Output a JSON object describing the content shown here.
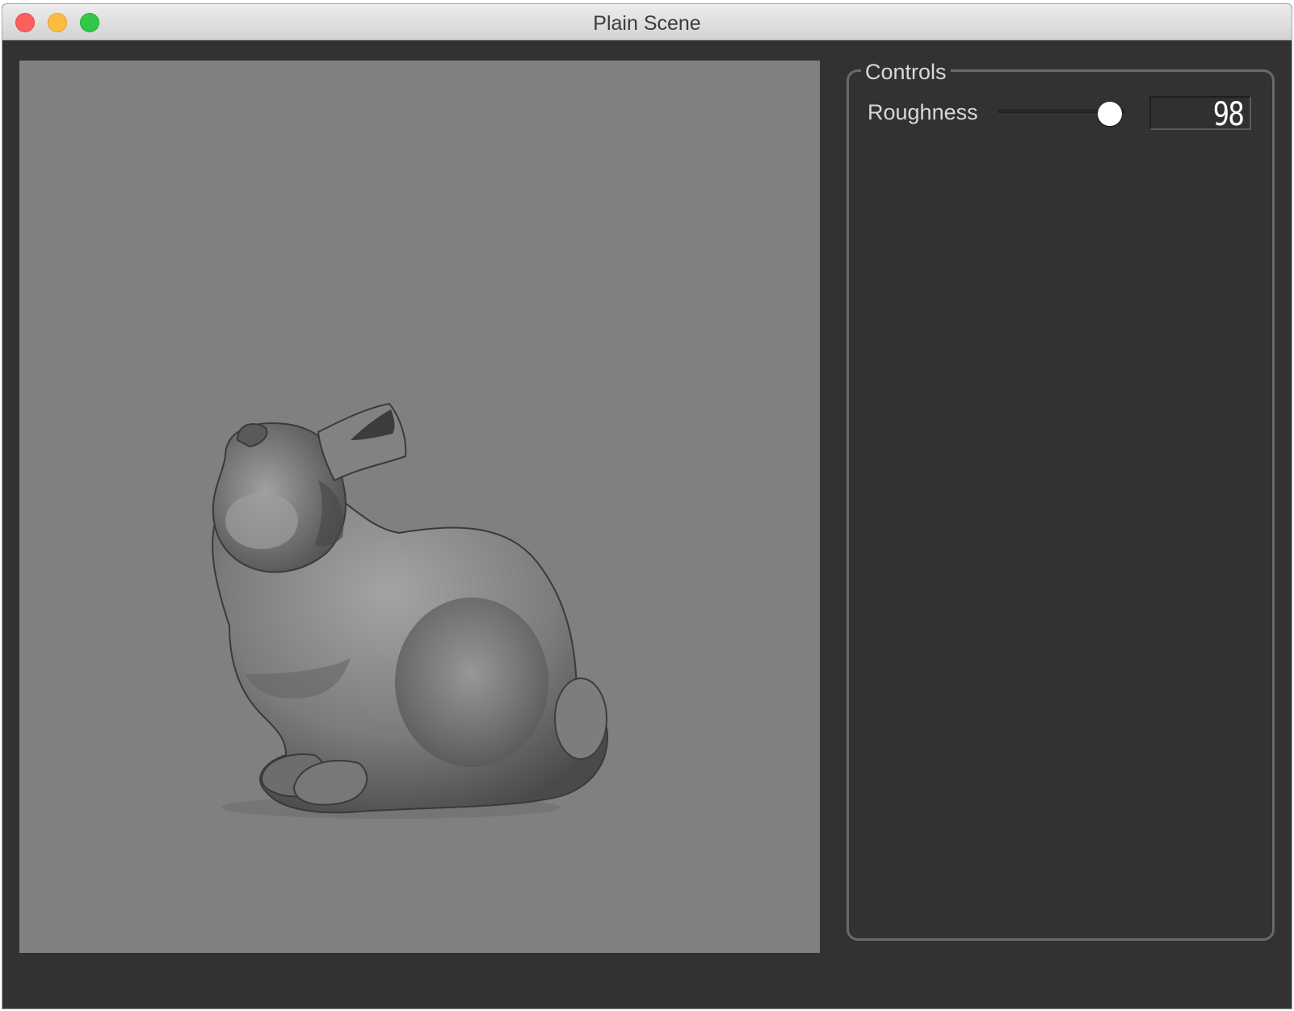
{
  "window": {
    "title": "Plain Scene",
    "buttons": {
      "close": "close-icon",
      "minimize": "minimize-icon",
      "zoom": "zoom-icon"
    }
  },
  "viewport": {
    "background_color": "#808080",
    "object": "bunny-model"
  },
  "controls": {
    "group_title": "Controls",
    "roughness": {
      "label": "Roughness",
      "value": "98",
      "slider_fraction": 0.88
    }
  }
}
